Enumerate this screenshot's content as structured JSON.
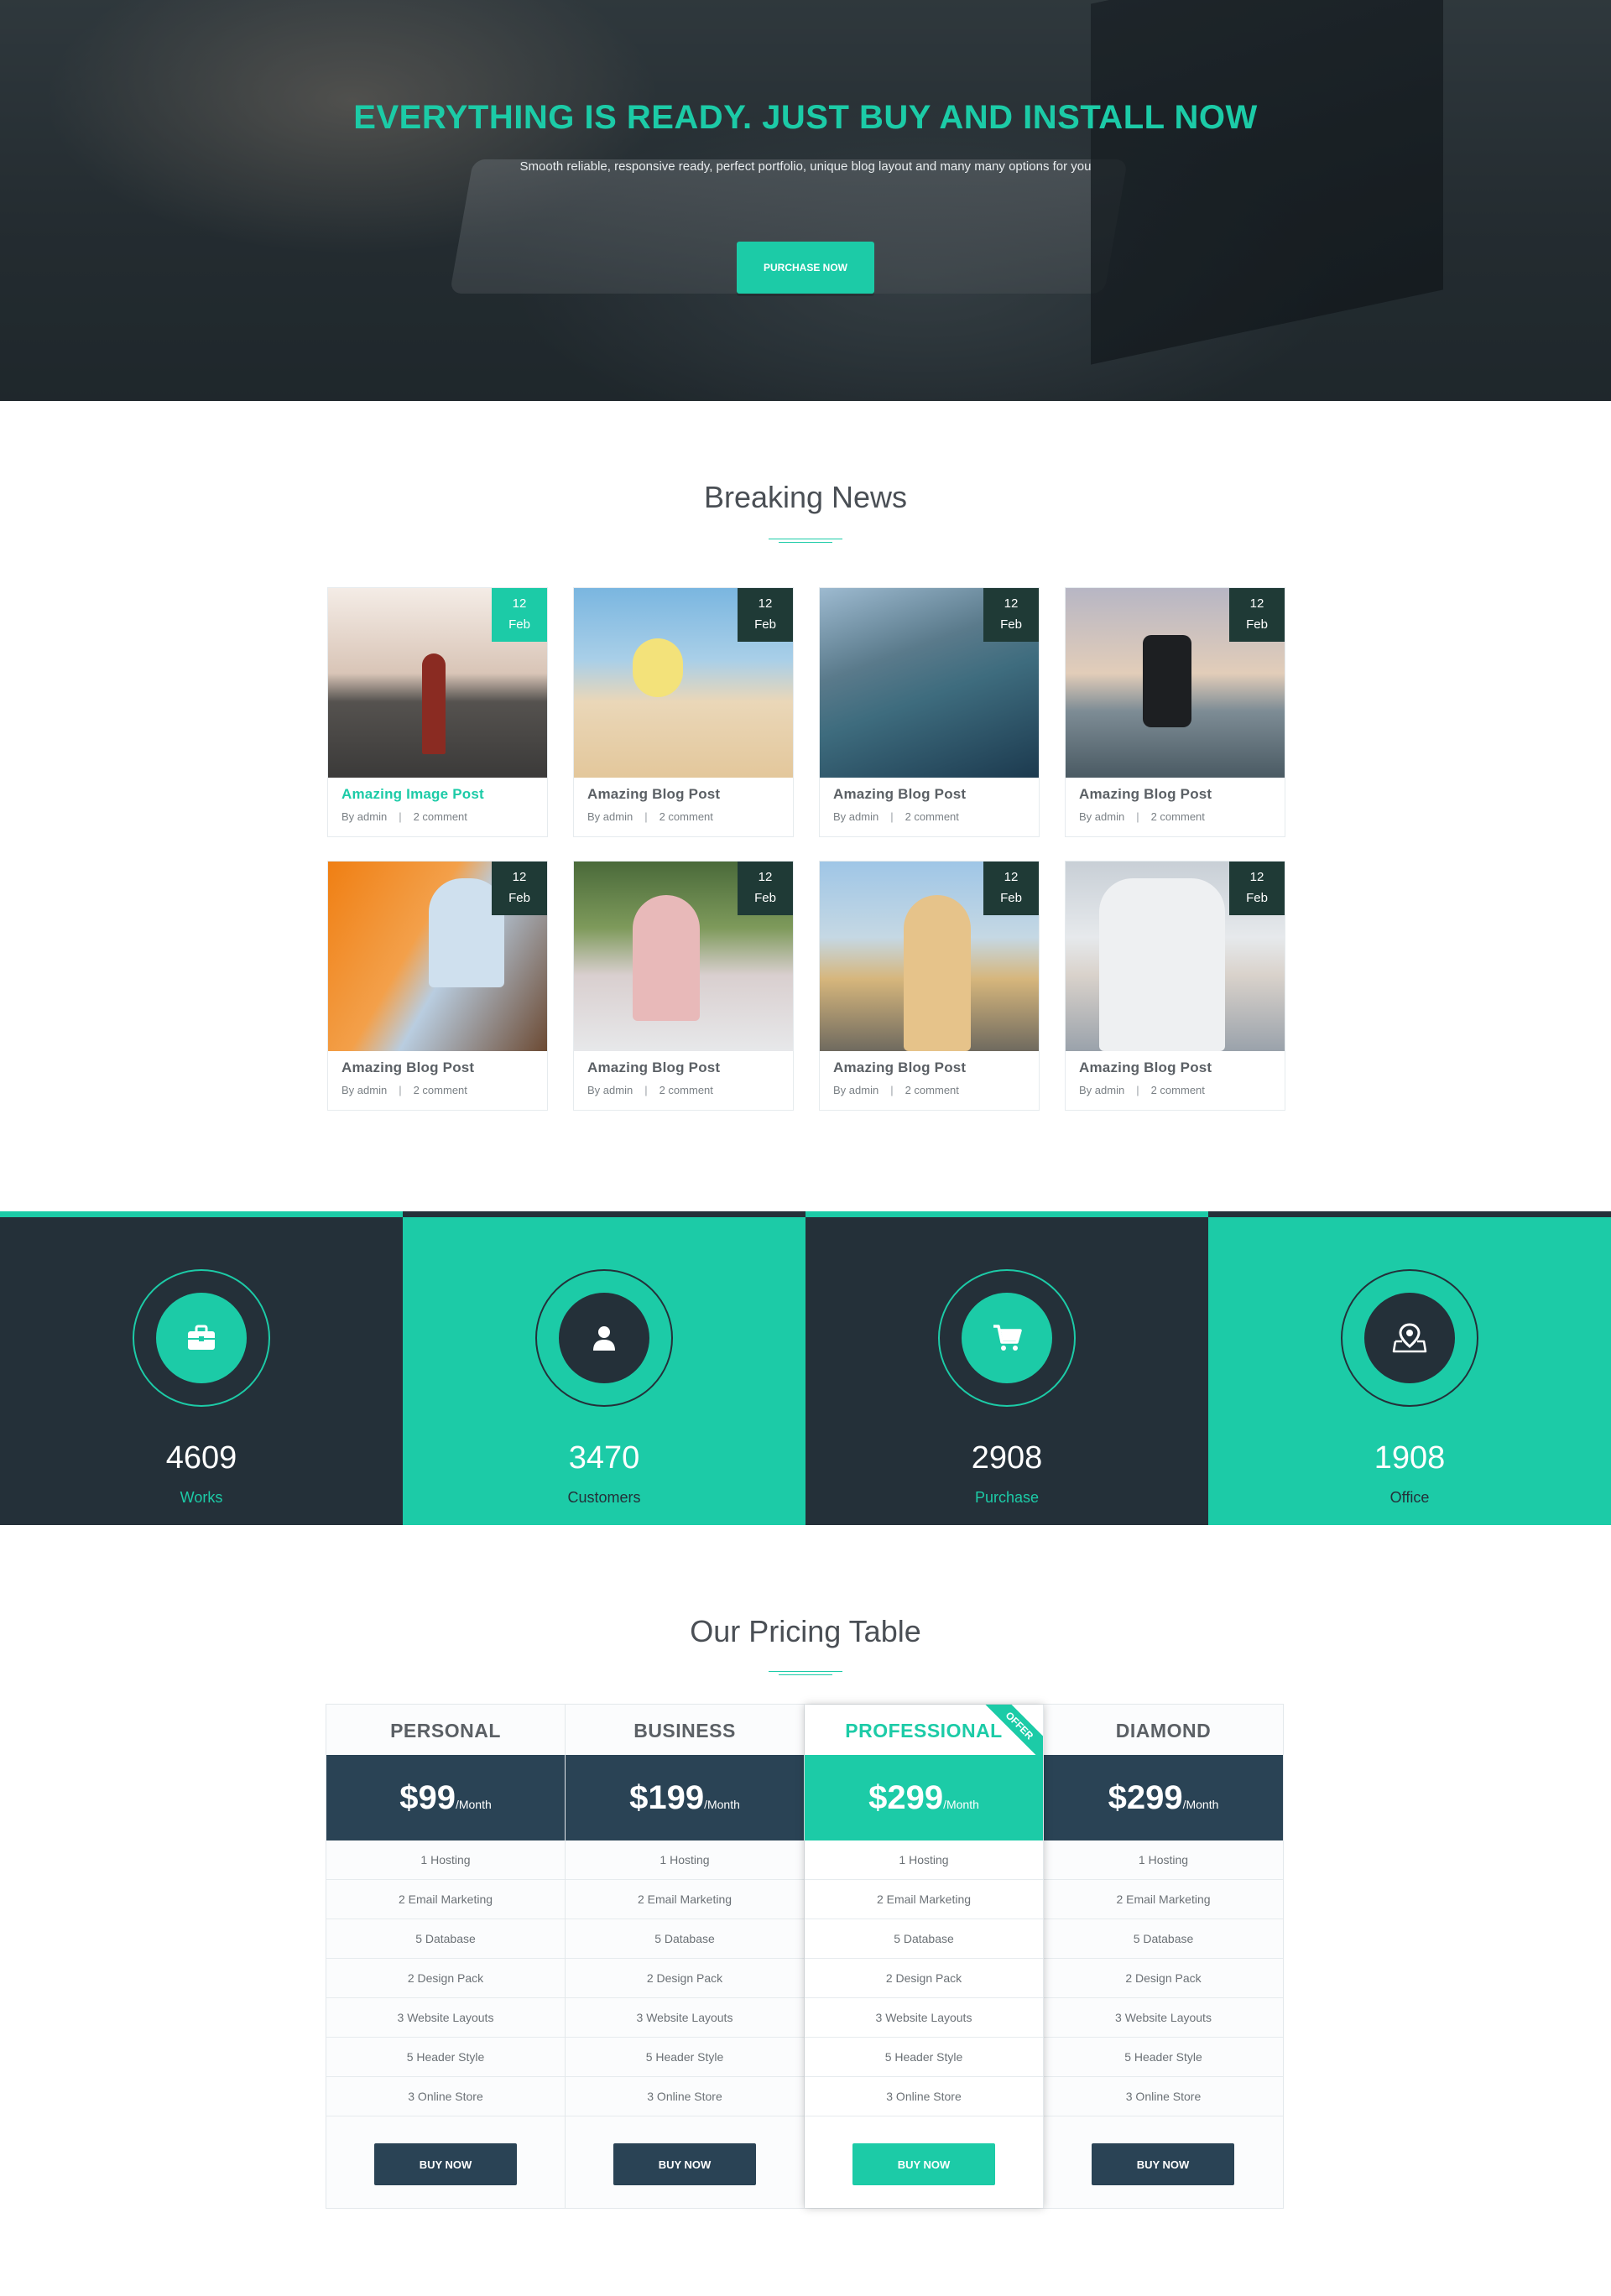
{
  "hero": {
    "title": "EVERYTHING IS READY. JUST BUY AND INSTALL NOW",
    "subtitle": "Smooth reliable, responsive ready, perfect portfolio, unique blog layout and many many options for you",
    "button": "PURCHASE NOW"
  },
  "news": {
    "title": "Breaking News",
    "posts": [
      {
        "title": "Amazing Image Post",
        "day": "12",
        "month": "Feb",
        "author": "By admin",
        "comments": "2 comment",
        "active": true
      },
      {
        "title": "Amazing Blog Post",
        "day": "12",
        "month": "Feb",
        "author": "By admin",
        "comments": "2 comment"
      },
      {
        "title": "Amazing Blog Post",
        "day": "12",
        "month": "Feb",
        "author": "By admin",
        "comments": "2 comment"
      },
      {
        "title": "Amazing Blog Post",
        "day": "12",
        "month": "Feb",
        "author": "By admin",
        "comments": "2 comment"
      },
      {
        "title": "Amazing Blog Post",
        "day": "12",
        "month": "Feb",
        "author": "By admin",
        "comments": "2 comment"
      },
      {
        "title": "Amazing Blog Post",
        "day": "12",
        "month": "Feb",
        "author": "By admin",
        "comments": "2 comment"
      },
      {
        "title": "Amazing Blog Post",
        "day": "12",
        "month": "Feb",
        "author": "By admin",
        "comments": "2 comment"
      },
      {
        "title": "Amazing Blog Post",
        "day": "12",
        "month": "Feb",
        "author": "By admin",
        "comments": "2 comment"
      }
    ]
  },
  "counters": [
    {
      "value": "4609",
      "label": "Works",
      "icon": "briefcase-icon"
    },
    {
      "value": "3470",
      "label": "Customers",
      "icon": "user-icon"
    },
    {
      "value": "2908",
      "label": "Purchase",
      "icon": "shopping-cart-icon"
    },
    {
      "value": "1908",
      "label": "Office",
      "icon": "map-pin-icon"
    }
  ],
  "pricing": {
    "title": "Our Pricing Table",
    "ribbon": "OFFER",
    "plans": [
      {
        "name": "PERSONAL",
        "price": "$99",
        "period": "/Month",
        "button": "BUY NOW",
        "features": [
          "1 Hosting",
          "2 Email Marketing",
          "5 Database",
          "2 Design Pack",
          "3 Website Layouts",
          "5 Header Style",
          "3 Online Store"
        ]
      },
      {
        "name": "BUSINESS",
        "price": "$199",
        "period": "/Month",
        "button": "BUY NOW",
        "features": [
          "1 Hosting",
          "2 Email Marketing",
          "5 Database",
          "2 Design Pack",
          "3 Website Layouts",
          "5 Header Style",
          "3 Online Store"
        ]
      },
      {
        "name": "PROFESSIONAL",
        "price": "$299",
        "period": "/Month",
        "button": "BUY NOW",
        "features": [
          "1 Hosting",
          "2 Email Marketing",
          "5 Database",
          "2 Design Pack",
          "3 Website Layouts",
          "5 Header Style",
          "3 Online Store"
        ]
      },
      {
        "name": "DIAMOND",
        "price": "$299",
        "period": "/Month",
        "button": "BUY NOW",
        "features": [
          "1 Hosting",
          "2 Email Marketing",
          "5 Database",
          "2 Design Pack",
          "3 Website Layouts",
          "5 Header Style",
          "3 Online Store"
        ]
      }
    ]
  },
  "colors": {
    "accent": "#1ccba7",
    "dark": "#243039",
    "price_bg": "#2a4355"
  }
}
